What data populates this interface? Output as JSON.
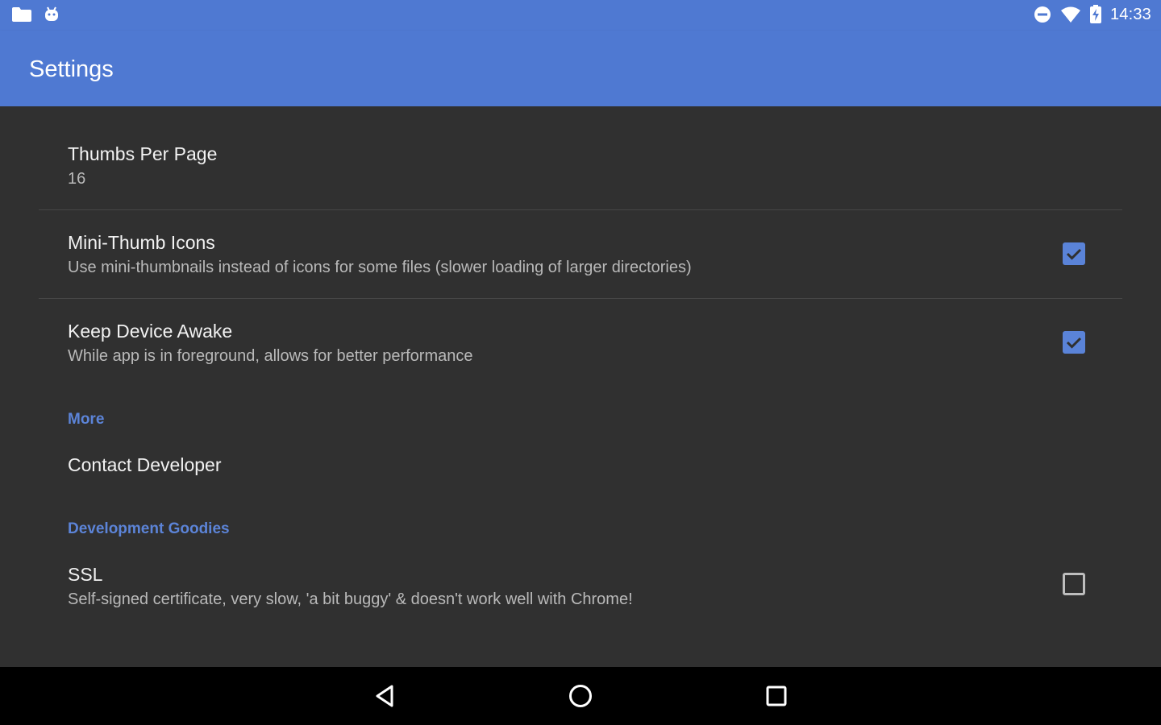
{
  "status_bar": {
    "left_icons": [
      "folder-icon",
      "android-debug-icon"
    ],
    "right_icons": [
      "do-not-disturb-icon",
      "wifi-icon",
      "battery-charging-icon"
    ],
    "time": "14:33"
  },
  "app_bar": {
    "title": "Settings",
    "color": "#4f79d2"
  },
  "preferences": {
    "thumbs_per_page": {
      "title": "Thumbs Per Page",
      "summary": "16"
    },
    "mini_thumb_icons": {
      "title": "Mini-Thumb Icons",
      "summary": "Use mini-thumbnails instead of icons for some files (slower loading of larger directories)",
      "checked": true
    },
    "keep_device_awake": {
      "title": "Keep Device Awake",
      "summary": "While app is in foreground, allows for better performance",
      "checked": true
    },
    "more_category": "More",
    "contact_developer": {
      "title": "Contact Developer"
    },
    "dev_category": "Development Goodies",
    "ssl": {
      "title": "SSL",
      "summary": "Self-signed certificate, very slow, 'a bit buggy' & doesn't work well with Chrome!",
      "checked": false
    }
  },
  "nav_bar": {
    "buttons": [
      "back-icon",
      "home-icon",
      "recents-icon"
    ]
  }
}
